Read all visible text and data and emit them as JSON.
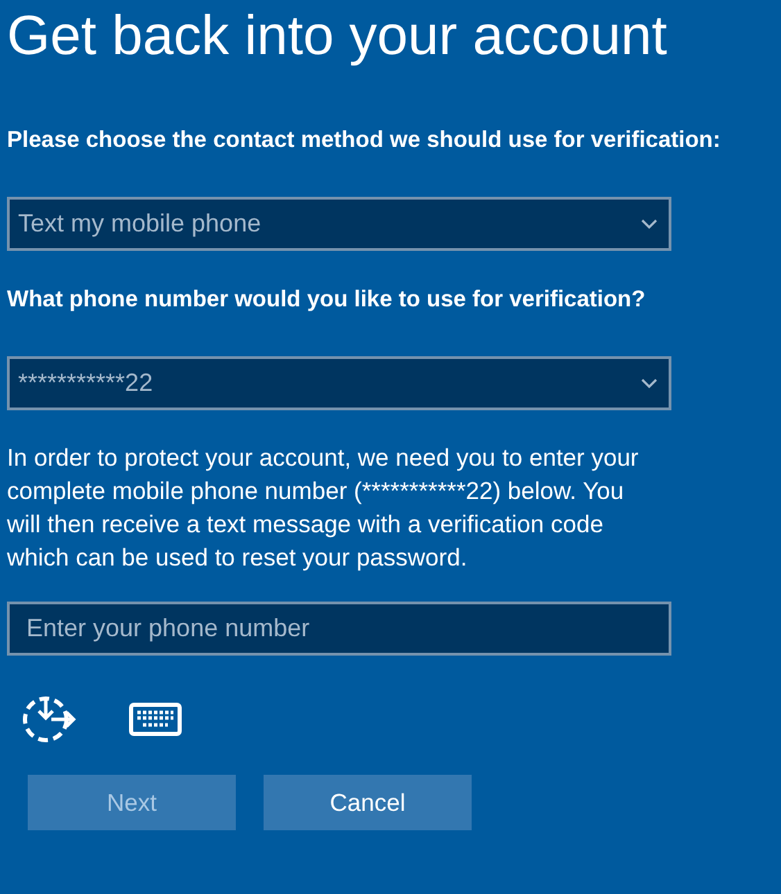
{
  "title": "Get back into your account",
  "contact_method": {
    "label": "Please choose the contact method we should use for verification:",
    "value": "Text my mobile phone"
  },
  "phone_choice": {
    "label": "What phone number would you like to use for verification?",
    "value": "***********22"
  },
  "instructions": "In order to protect your account, we need you to enter your complete mobile phone number (***********22) below. You will then receive a text message with a verification code which can be used to reset your password.",
  "phone_field": {
    "placeholder": "Enter your phone number"
  },
  "buttons": [
    {
      "label": "Next",
      "disabled": true
    },
    {
      "label": "Cancel",
      "disabled": false
    }
  ]
}
